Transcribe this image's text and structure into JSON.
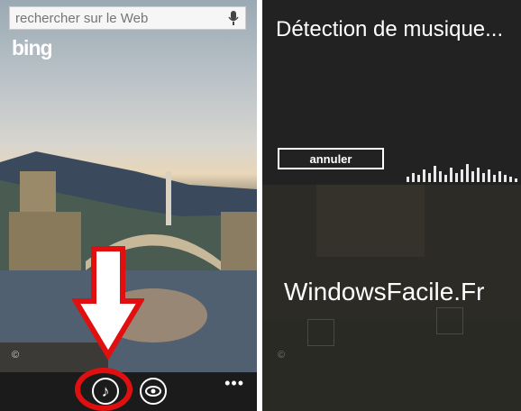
{
  "left_phone": {
    "search": {
      "placeholder": "rechercher sur le Web"
    },
    "logo": "bing",
    "copyright": "©",
    "appbar": {
      "more": "•••"
    }
  },
  "right_phone": {
    "title": "Détection de musique...",
    "cancel_label": "annuler",
    "copyright": "©",
    "watermark": "WindowsFacile.Fr"
  },
  "colors": {
    "highlight": "#e01010",
    "appbar": "#1b1b1b",
    "panel_bg": "#2b2a26"
  }
}
